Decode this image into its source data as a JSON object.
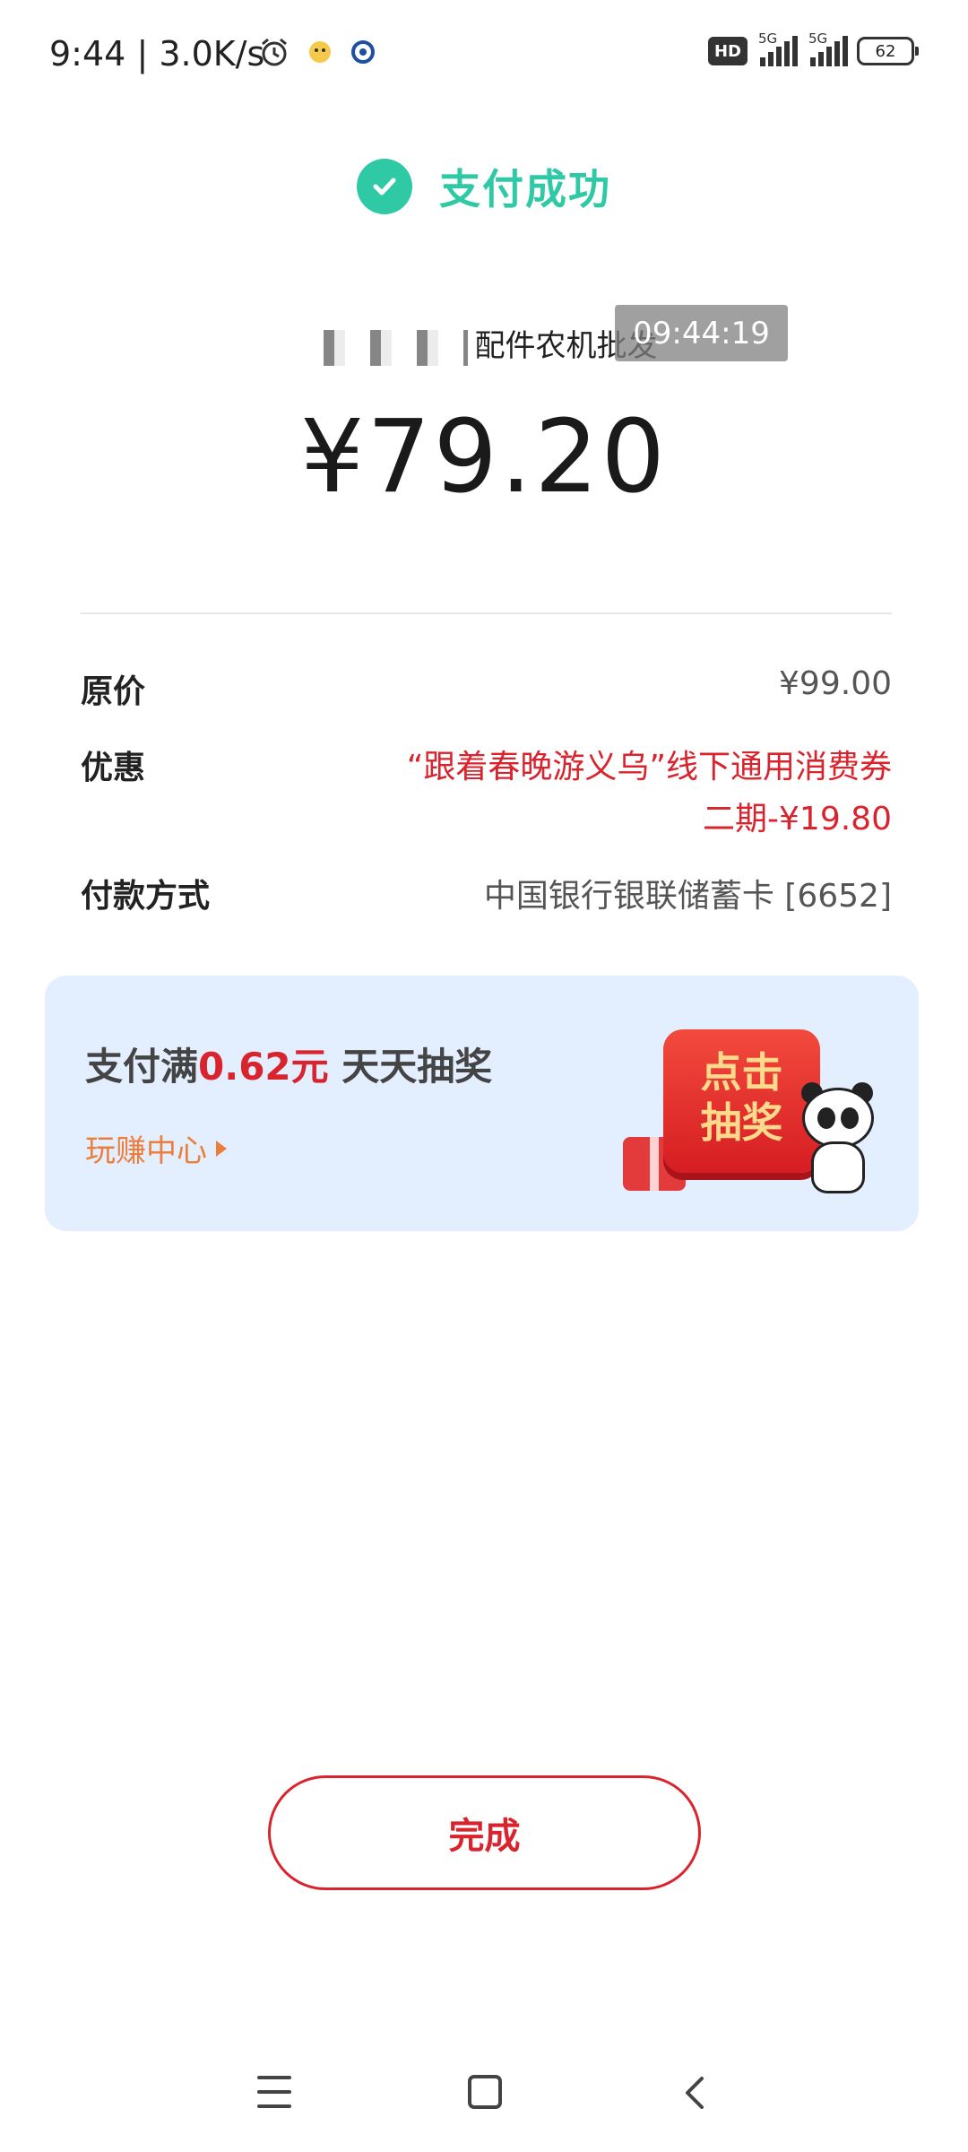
{
  "status_bar": {
    "time": "9:44",
    "speed": "3.0K/s",
    "hd": "HD",
    "network1": "5G",
    "network2": "5G",
    "battery": "62"
  },
  "header": {
    "title": "支付成功"
  },
  "merchant": {
    "name": "配件农机批发",
    "timestamp": "09:44:19"
  },
  "amount": "¥79.20",
  "details": {
    "original_label": "原价",
    "original_value": "¥99.00",
    "discount_label": "优惠",
    "discount_value": "“跟着春晚游义乌”线下通用消费券二期-¥19.80",
    "payment_label": "付款方式",
    "payment_value": "中国银行银联储蓄卡 [6652]"
  },
  "promo": {
    "prefix": "支付满",
    "amount": "0.62元",
    "suffix": " 天天抽奖",
    "link": "玩赚中心",
    "button_line1": "点击",
    "button_line2": "抽奖"
  },
  "done_button": "完成",
  "colors": {
    "success": "#2fc9a5",
    "accent_red": "#d9232d",
    "promo_bg": "#e3efff",
    "promo_link": "#ec7d3a"
  }
}
